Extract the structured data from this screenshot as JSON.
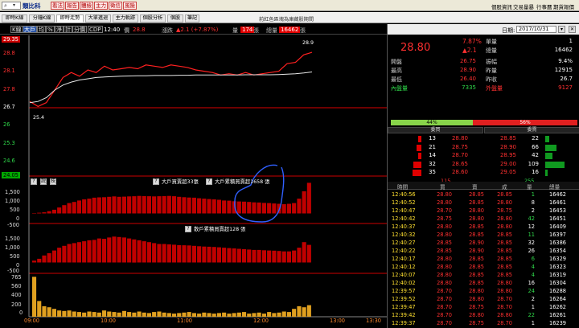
{
  "topbar": {
    "stock_name": "類比科",
    "buttons": [
      "看法",
      "報告",
      "體檢",
      "主力",
      "徵信",
      "風險"
    ],
    "links": [
      "個股資訊",
      "交易量暴",
      "行事曆",
      "期貨報價"
    ]
  },
  "tabs": {
    "items": [
      "即時K線",
      "分鐘K線",
      "即時走勢",
      "大單進退",
      "主力軌跡",
      "個股分析",
      "個股",
      "筆記"
    ],
    "active": 2,
    "window_title": "前紅色區塊為庫藏股期間"
  },
  "infobar": {
    "modes": [
      "K線",
      "大戶",
      "均",
      "%",
      "淨",
      "計",
      "分價",
      "CDP"
    ],
    "selected_mode": 1,
    "time": "12:40",
    "price_label": "價",
    "price": "28.8",
    "change_label": "漲跌",
    "change": "▲2.1 (+7.87%)",
    "vol_label": "量",
    "vol": "174",
    "vol_unit": "張",
    "total_label": "總量",
    "total": "16462",
    "total_unit": "張"
  },
  "price_axis": {
    "top": "29.35",
    "labels": [
      "28.8",
      "28.1",
      "27.8",
      "26.7",
      "26",
      "25.3",
      "24.6",
      "24.05"
    ],
    "low_marker": "25.4",
    "high_marker": "28.9"
  },
  "panel2": {
    "title": "大戶買賣超33張",
    "annot": "大戶累積買賣超1658 張",
    "yticks": [
      "1,500",
      "1,000",
      "500",
      "0",
      "-500"
    ],
    "buttons": [
      "?",
      "說",
      "技"
    ]
  },
  "panel3": {
    "title": "散戶累積買賣超128 張",
    "yticks": [
      "1,500",
      "1,000",
      "500",
      "0",
      "-500"
    ]
  },
  "panel4": {
    "yticks": [
      "765",
      "560",
      "400",
      "200",
      "0"
    ]
  },
  "xaxis": [
    "09:00",
    "10:00",
    "11:00",
    "12:00",
    "13:00",
    "13:30"
  ],
  "colors": {
    "up": "#ff2020",
    "down": "#20d040",
    "bar": "#c00000"
  },
  "chart_data": [
    {
      "type": "line",
      "series": [
        {
          "values": [
            26.95,
            26.75,
            26.9,
            27.4,
            27.9,
            28.1,
            27.95,
            28.2,
            28.1,
            28.35,
            28.2,
            28.25,
            28.3,
            28.25,
            28.4,
            28.35,
            28.3,
            28.4,
            28.35,
            28.3,
            28.2,
            28.15,
            28.1,
            28.0,
            28.05,
            28.0,
            28.1,
            28.0,
            28.05,
            28.1,
            28.15,
            28.45,
            28.5,
            28.8,
            28.9
          ]
        },
        {
          "values": [
            26.9,
            26.95,
            27.1,
            27.4,
            27.6,
            27.72,
            27.8,
            27.85,
            27.9,
            27.92,
            27.94,
            27.95,
            27.96,
            27.97,
            27.97,
            27.98,
            27.98,
            27.98,
            27.99,
            27.99,
            28.0,
            28.0,
            28.0,
            28.0,
            28.0,
            28.0,
            28.01,
            28.01,
            28.01,
            28.01,
            28.02,
            28.03,
            28.05,
            28.08,
            28.12
          ]
        }
      ],
      "ylim": [
        24.05,
        29.35
      ]
    },
    {
      "type": "bar",
      "values": [
        0,
        40,
        60,
        120,
        200,
        320,
        450,
        560,
        620,
        700,
        760,
        800,
        850,
        870,
        880,
        900,
        920,
        900,
        910,
        920,
        930,
        950,
        940,
        930,
        920,
        930,
        940,
        950,
        930,
        900,
        880,
        860,
        850,
        820,
        800,
        780,
        760,
        740,
        700,
        690,
        660,
        650,
        640,
        620,
        600,
        590,
        570,
        560,
        540,
        520,
        500,
        520,
        560,
        800,
        1200,
        1658
      ],
      "ylim": [
        -500,
        1500
      ]
    },
    {
      "type": "bar",
      "values": [
        100,
        200,
        380,
        500,
        650,
        800,
        900,
        1000,
        1050,
        1100,
        1150,
        1200,
        1220,
        1300,
        1280,
        1350,
        1400,
        1380,
        1350,
        1300,
        1250,
        1200,
        1150,
        1100,
        1050,
        1000,
        1000,
        980,
        960,
        940,
        930,
        920,
        900,
        880,
        860,
        850,
        840,
        820,
        800,
        780,
        760,
        740,
        720,
        700,
        680,
        680,
        660,
        650,
        640,
        620,
        600,
        600,
        650,
        800,
        1100,
        950
      ],
      "ylim": [
        -500,
        1500
      ]
    },
    {
      "type": "bar",
      "values": [
        760,
        300,
        200,
        180,
        150,
        120,
        110,
        120,
        100,
        90,
        80,
        100,
        90,
        80,
        120,
        100,
        90,
        80,
        110,
        90,
        80,
        100,
        80,
        70,
        90,
        100,
        80,
        70,
        60,
        70,
        80,
        90,
        70,
        60,
        80,
        70,
        60,
        70,
        80,
        60,
        70,
        80,
        90,
        60,
        70,
        80,
        60,
        90,
        70,
        80,
        100,
        90,
        150,
        200,
        180,
        220
      ],
      "ylim": [
        0,
        765
      ]
    }
  ],
  "right": {
    "date_label": "日期:",
    "date": "2017/10/31",
    "price": "28.80",
    "pct": "7.87%",
    "chg": "▲2.1",
    "stats": [
      {
        "l": "單量",
        "v": "1"
      },
      {
        "l": "總量",
        "v": "16462"
      },
      {
        "l": "開盤",
        "v": "26.75"
      },
      {
        "l": "振幅",
        "v": "9.4%"
      },
      {
        "l": "最高",
        "v": "28.90"
      },
      {
        "l": "昨量",
        "v": "12915"
      },
      {
        "l": "最低",
        "v": "26.40"
      },
      {
        "l": "昨收",
        "v": "26.7"
      },
      {
        "l": "內盤量",
        "v": "7335"
      },
      {
        "l": "外盤量",
        "v": "9127"
      }
    ],
    "pbar_left": "44%",
    "pbar_right": "56%",
    "ob_head": [
      "委買",
      "委賣"
    ],
    "orderbook": [
      {
        "bq": "13",
        "bp": "28.80",
        "ap": "28.85",
        "aq": "22"
      },
      {
        "bq": "21",
        "bp": "28.75",
        "ap": "28.90",
        "aq": "66"
      },
      {
        "bq": "14",
        "bp": "28.70",
        "ap": "28.95",
        "aq": "42"
      },
      {
        "bq": "32",
        "bp": "28.65",
        "ap": "29.00",
        "aq": "109"
      },
      {
        "bq": "35",
        "bp": "28.60",
        "ap": "29.05",
        "aq": "16"
      }
    ],
    "ob_sum": [
      "115",
      "255"
    ],
    "tick_head": [
      "時間",
      "買",
      "賣",
      "成",
      "量",
      "總量"
    ],
    "ticks": [
      {
        "t": "12:40:56",
        "b": "28.80",
        "s": "28.85",
        "p": "28.85",
        "q": "1",
        "v": "16462"
      },
      {
        "t": "12:40:52",
        "b": "28.80",
        "s": "28.85",
        "p": "28.80",
        "q": "8",
        "v": "16461"
      },
      {
        "t": "12:40:47",
        "b": "28.70",
        "s": "28.80",
        "p": "28.75",
        "q": "2",
        "v": "16453"
      },
      {
        "t": "12:40:42",
        "b": "28.75",
        "s": "28.80",
        "p": "28.80",
        "q": "42",
        "v": "16451"
      },
      {
        "t": "12:40:37",
        "b": "28.80",
        "s": "28.85",
        "p": "28.80",
        "q": "12",
        "v": "16409"
      },
      {
        "t": "12:40:32",
        "b": "28.80",
        "s": "28.85",
        "p": "28.85",
        "q": "11",
        "v": "16397"
      },
      {
        "t": "12:40:27",
        "b": "28.85",
        "s": "28.90",
        "p": "28.85",
        "q": "32",
        "v": "16386"
      },
      {
        "t": "12:40:22",
        "b": "28.85",
        "s": "28.90",
        "p": "28.85",
        "q": "26",
        "v": "16354"
      },
      {
        "t": "12:40:17",
        "b": "28.80",
        "s": "28.85",
        "p": "28.85",
        "q": "6",
        "v": "16329"
      },
      {
        "t": "12:40:12",
        "b": "28.80",
        "s": "28.85",
        "p": "28.85",
        "q": "4",
        "v": "16323"
      },
      {
        "t": "12:40:07",
        "b": "28.80",
        "s": "28.85",
        "p": "28.85",
        "q": "4",
        "v": "16319"
      },
      {
        "t": "12:40:02",
        "b": "28.80",
        "s": "28.85",
        "p": "28.80",
        "q": "16",
        "v": "16304"
      },
      {
        "t": "12:39:57",
        "b": "28.70",
        "s": "28.80",
        "p": "28.80",
        "q": "24",
        "v": "16288"
      },
      {
        "t": "12:39:52",
        "b": "28.70",
        "s": "28.80",
        "p": "28.70",
        "q": "2",
        "v": "16264"
      },
      {
        "t": "12:39:47",
        "b": "28.70",
        "s": "28.75",
        "p": "28.70",
        "q": "1",
        "v": "16262"
      },
      {
        "t": "12:39:42",
        "b": "28.70",
        "s": "28.80",
        "p": "28.80",
        "q": "22",
        "v": "16261"
      },
      {
        "t": "12:39:37",
        "b": "28.70",
        "s": "28.75",
        "p": "28.70",
        "q": "1",
        "v": "16239"
      }
    ]
  }
}
